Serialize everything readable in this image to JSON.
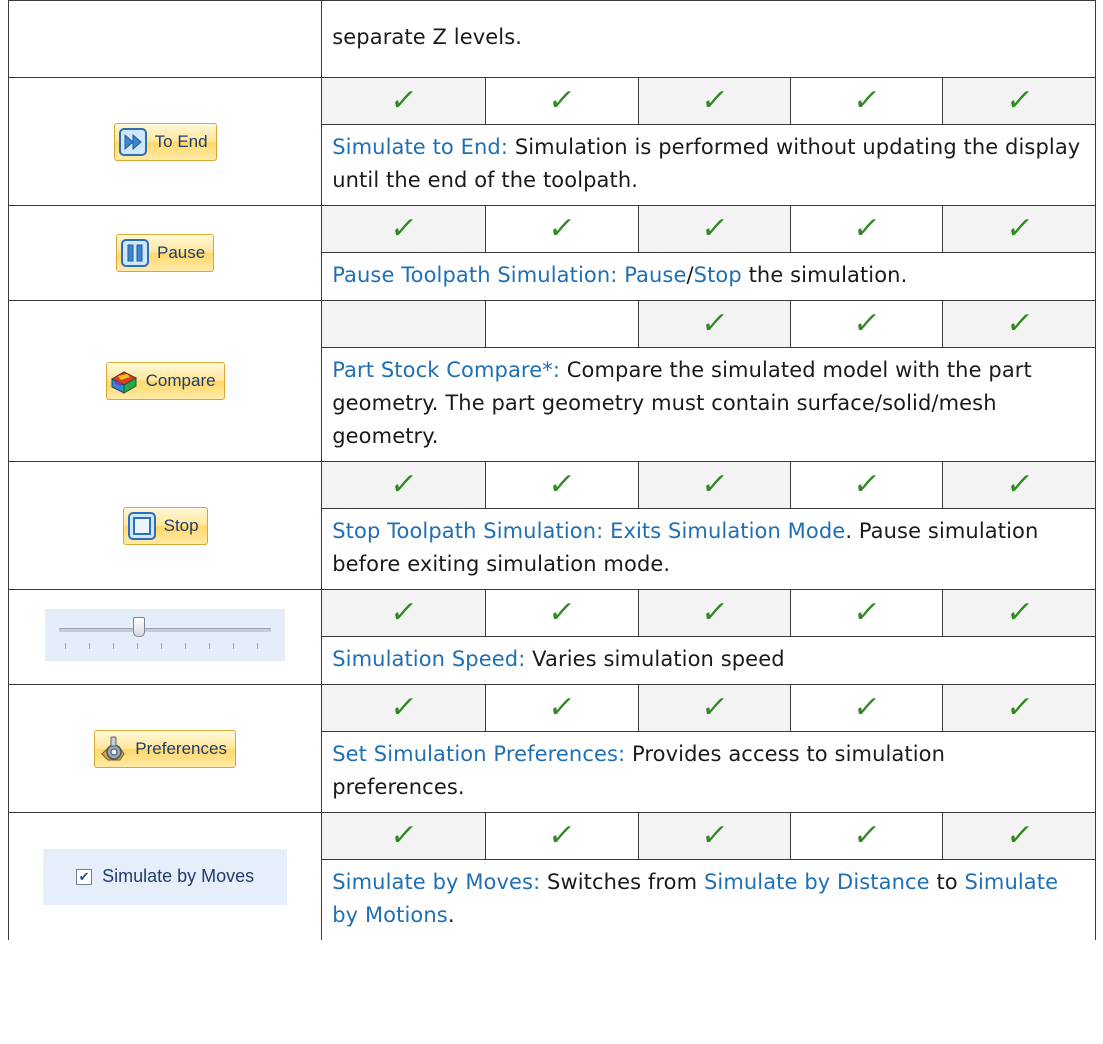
{
  "rows": [
    {
      "id": "top",
      "desc_tail": "separate Z levels."
    },
    {
      "id": "to-end",
      "button_label": "To End",
      "icon": "fast-forward-icon",
      "checks": [
        true,
        true,
        true,
        true,
        true
      ],
      "term": "Simulate to End:",
      "desc": " Simulation is performed without updating the display until the end of the toolpath."
    },
    {
      "id": "pause",
      "button_label": "Pause",
      "icon": "pause-icon",
      "checks": [
        true,
        true,
        true,
        true,
        true
      ],
      "term": "Pause Toolpath Simulation:",
      "term_a": "Pause",
      "sep": "/",
      "term_b": "Stop",
      "desc": " the simulation."
    },
    {
      "id": "compare",
      "button_label": "Compare",
      "icon": "part-stock-compare-icon",
      "checks": [
        false,
        false,
        true,
        true,
        true
      ],
      "term": "Part Stock Compare*:",
      "desc": " Compare the simulated model with the part geometry. The part geometry must contain surface/solid/mesh geometry."
    },
    {
      "id": "stop",
      "button_label": "Stop",
      "icon": "stop-icon",
      "checks": [
        true,
        true,
        true,
        true,
        true
      ],
      "term": "Stop Toolpath Simulation: Exits Simulation Mode",
      "desc": ". Pause simulation before exiting simulation mode."
    },
    {
      "id": "speed",
      "slider_value": 0.37,
      "checks": [
        true,
        true,
        true,
        true,
        true
      ],
      "term": "Simulation Speed:",
      "desc": " Varies simulation speed"
    },
    {
      "id": "preferences",
      "button_label": "Preferences",
      "icon": "preferences-gear-icon",
      "checks": [
        true,
        true,
        true,
        true,
        true
      ],
      "term": "Set Simulation Preferences:",
      "desc": " Provides access to simulation preferences."
    },
    {
      "id": "by-moves",
      "checkbox_label": "Simulate by Moves",
      "checkbox_checked": true,
      "checks": [
        true,
        true,
        true,
        true,
        true
      ],
      "term": "Simulate by Moves:",
      "desc_a": " Switches from ",
      "term_a": "Simulate by Distance",
      "desc_b": " to ",
      "term_b": "Simulate by Motions",
      "desc_c": "."
    }
  ],
  "check_glyph": "✓",
  "colors": {
    "term": "#1f6fb5",
    "check": "#2f8a21",
    "ribbon": "#ffe79a"
  }
}
